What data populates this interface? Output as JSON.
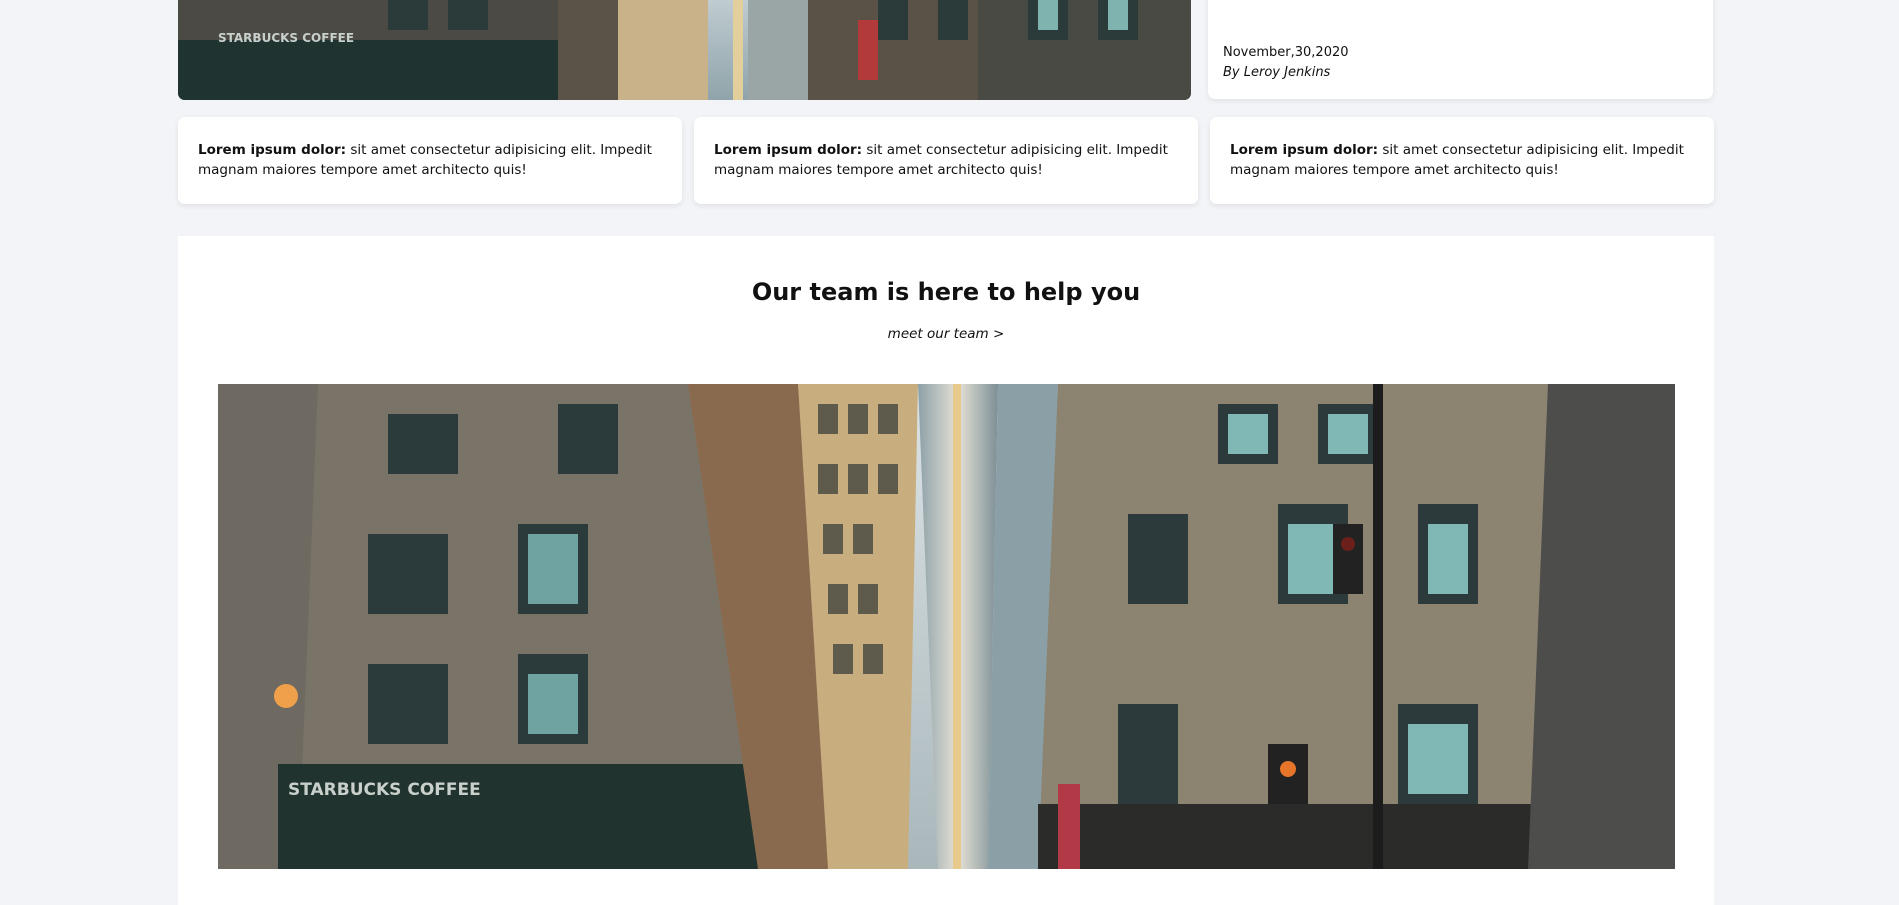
{
  "featured": {
    "date": "November,30,2020",
    "author": "By Leroy Jenkins",
    "image_sign_text": "STARBUCKS COFFEE"
  },
  "cards": [
    {
      "bold": "Lorem ipsum dolor:",
      "text": " sit amet consectetur adipisicing elit. Impedit magnam maiores tempore amet architecto quis!"
    },
    {
      "bold": "Lorem ipsum dolor:",
      "text": " sit amet consectetur adipisicing elit. Impedit magnam maiores tempore amet architecto quis!"
    },
    {
      "bold": "Lorem ipsum dolor:",
      "text": " sit amet consectetur adipisicing elit. Impedit magnam maiores tempore amet architecto quis!"
    }
  ],
  "team": {
    "title": "Our team is here to help you",
    "link": "meet our team >",
    "image_sign_text": "STARBUCKS COFFEE"
  },
  "colors": {
    "page_bg": "#f2f4f7",
    "card_bg": "#ffffff",
    "text": "#111111"
  }
}
